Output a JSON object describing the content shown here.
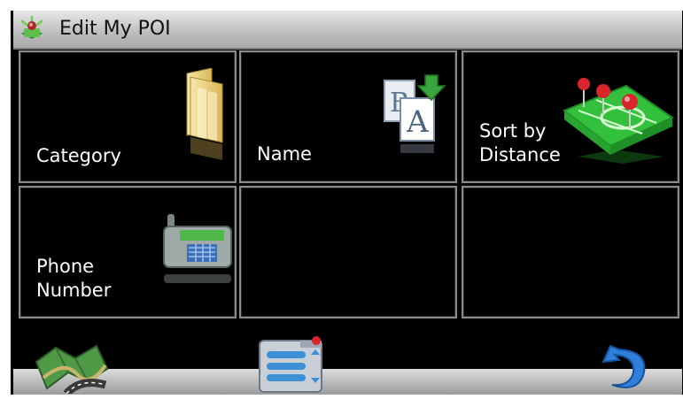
{
  "window": {
    "title": "Edit My POI"
  },
  "tiles": [
    {
      "label": "Category",
      "icon": "folder-icon"
    },
    {
      "label": "Name",
      "icon": "rename-letters-icon"
    },
    {
      "label_line1": "Sort by",
      "label_line2": "Distance",
      "icon": "map-pins-icon"
    },
    {
      "label_line1": "Phone",
      "label_line2": "Number",
      "icon": "phone-fax-icon"
    },
    {
      "label": "",
      "icon": ""
    },
    {
      "label": "",
      "icon": ""
    }
  ],
  "bottom": {
    "left_icon": "map-icon",
    "center_icon": "menu-list-icon",
    "right_icon": "back-arrow-icon"
  },
  "colors": {
    "background": "#000000",
    "tile_border": "#8b8b8b",
    "title_bar": "#bdbdbd",
    "accent_green": "#2fb83a"
  }
}
